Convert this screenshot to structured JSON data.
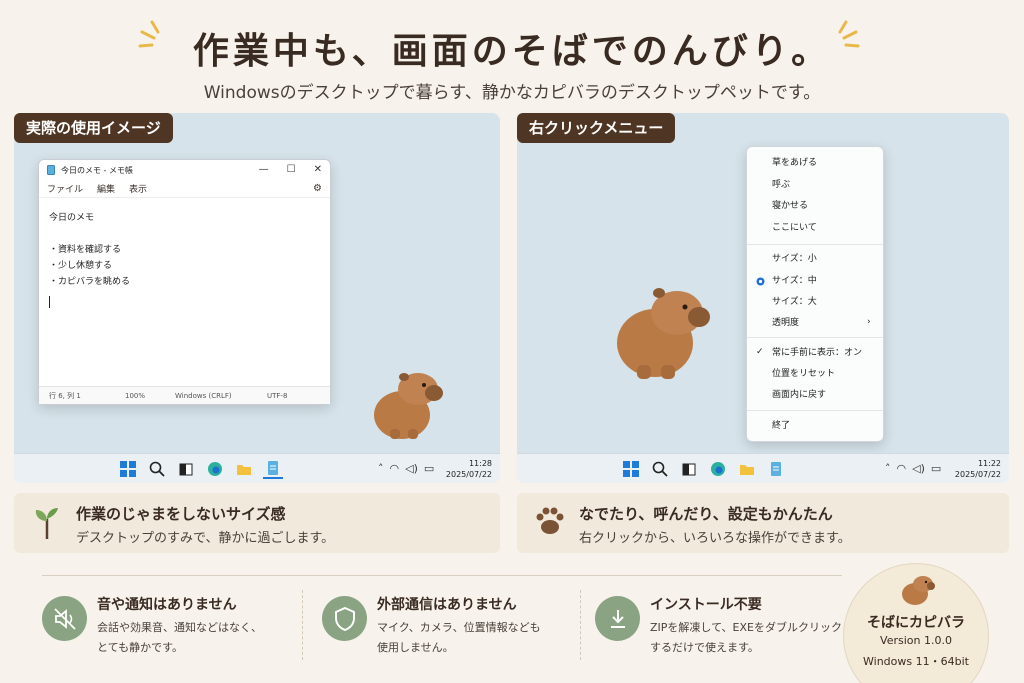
{
  "header": {
    "title": "作業中も、画面のそばでのんびり。",
    "subtitle": "Windowsのデスクトップで暮らす、静かなカピバラのデスクトップペットです。"
  },
  "left_panel": {
    "tag": "実際の使用イメージ",
    "notepad": {
      "title": "今日のメモ - メモ帳",
      "menu": [
        "ファイル",
        "編集",
        "表示"
      ],
      "lines": [
        "今日のメモ",
        "",
        "・資料を確認する",
        "・少し休憩する",
        "・カピバラを眺める"
      ],
      "status": [
        "行 6, 列 1",
        "100%",
        "Windows (CRLF)",
        "UTF-8"
      ]
    },
    "clock": {
      "time": "11:28",
      "date": "2025/07/22"
    }
  },
  "right_panel": {
    "tag": "右クリックメニュー",
    "menu_items": [
      {
        "label": "草をあげる"
      },
      {
        "label": "呼ぶ"
      },
      {
        "label": "寝かせる"
      },
      {
        "label": "ここにいて"
      },
      {
        "label": "サイズ：小"
      },
      {
        "label": "サイズ：中",
        "selected": true
      },
      {
        "label": "サイズ：大"
      },
      {
        "label": "透明度",
        "submenu": true
      },
      {
        "label": "常に手前に表示：オン",
        "checked": true
      },
      {
        "label": "位置をリセット"
      },
      {
        "label": "画面内に戻す"
      },
      {
        "label": "終了"
      }
    ],
    "clock": {
      "time": "11:22",
      "date": "2025/07/22"
    }
  },
  "cards": {
    "left": {
      "title": "作業のじゃまをしないサイズ感",
      "desc": "デスクトップのすみで、静かに過ごします。",
      "icon": "sprout-icon"
    },
    "right": {
      "title": "なでたり、呼んだり、設定もかんたん",
      "desc": "右クリックから、いろいろな操作ができます。",
      "icon": "paw-icon"
    }
  },
  "features": [
    {
      "title": "音や通知はありません",
      "line1": "会話や効果音、通知などはなく、",
      "line2": "とても静かです。",
      "icon": "mute-icon"
    },
    {
      "title": "外部通信はありません",
      "line1": "マイク、カメラ、位置情報なども",
      "line2": "使用しません。",
      "icon": "shield-icon"
    },
    {
      "title": "インストール不要",
      "line1": "ZIPを解凍して、EXEをダブルクリック",
      "line2": "するだけで使えます。",
      "icon": "download-icon"
    }
  ],
  "badge": {
    "name": "そばにカピバラ",
    "version": "Version 1.0.0",
    "os": "Windows 11・64bit"
  },
  "colors": {
    "background": "#f7f3ec",
    "tag_bg": "#4f3624",
    "desktop": "#d6e3ea",
    "card_bg": "#f1e9dc",
    "feature_icon": "#8aa382",
    "capybara": "#b97a45"
  }
}
